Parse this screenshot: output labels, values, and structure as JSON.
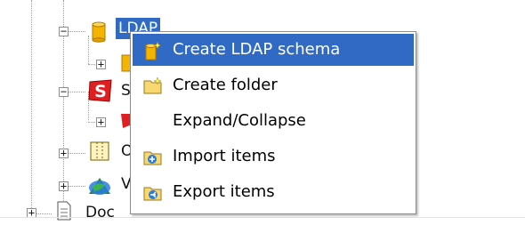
{
  "colors": {
    "selection": "#316ac5",
    "menu_border": "#8c8c8c",
    "tree_line": "#9a9a9a"
  },
  "tree": {
    "nodes": [
      {
        "label": "LDAP",
        "icon": "ldap-cylinder-icon",
        "expander": "−",
        "selected": true
      },
      {
        "label": "",
        "icon": "ldap-folder-icon",
        "expander": "+"
      },
      {
        "label": "S",
        "icon": "s-logo-icon",
        "expander": "−"
      },
      {
        "label": "",
        "icon": "red-item-icon",
        "expander": "+"
      },
      {
        "label": "O",
        "icon": "grid-table-icon",
        "expander": "+"
      },
      {
        "label": "V",
        "icon": "globe-icon",
        "expander": "+"
      },
      {
        "label": "Doc",
        "icon": "document-icon",
        "expander": "+"
      }
    ]
  },
  "context_menu": {
    "items": [
      {
        "label": "Create LDAP schema",
        "icon": "ldap-schema-create-icon",
        "highlighted": true
      },
      {
        "label": "Create folder",
        "icon": "folder-create-icon"
      },
      {
        "label": "Expand/Collapse",
        "icon": ""
      },
      {
        "label": "Import items",
        "icon": "import-items-icon"
      },
      {
        "label": "Export items",
        "icon": "export-items-icon"
      }
    ]
  }
}
